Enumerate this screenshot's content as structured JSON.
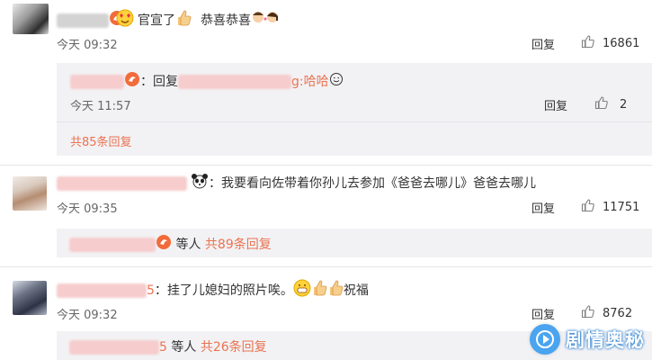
{
  "comments": [
    {
      "text_prefix": "：官宣了",
      "text_middle": "恭喜恭喜",
      "time": "今天 09:32",
      "reply_label": "回复",
      "likes": "16861",
      "sub_reply": {
        "prefix": "：回复",
        "suffix": "g:哈哈",
        "time": "今天 11:57",
        "reply_label": "回复",
        "likes": "2"
      },
      "total_replies": "共85条回复"
    },
    {
      "text": "：我要看向佐带着你孙儿去参加《爸爸去哪儿》爸爸去哪儿",
      "time": "今天 09:35",
      "reply_label": "回复",
      "likes": "11751",
      "others": "等人",
      "total_replies": "共89条回复"
    },
    {
      "name_tail": "5",
      "text": "：挂了儿媳妇的照片唉。",
      "text_end": "祝福",
      "time": "今天 09:32",
      "reply_label": "回复",
      "likes": "8762",
      "others_prefix": "5",
      "others": "等人",
      "total_replies": "共26条回复"
    }
  ],
  "watermark": {
    "text": "剧情奥秘"
  },
  "colors": {
    "link": "#eb7350",
    "reply_bg": "#f2f2f5",
    "divider": "#e6e6e6",
    "watermark": "#4aa4ef"
  }
}
